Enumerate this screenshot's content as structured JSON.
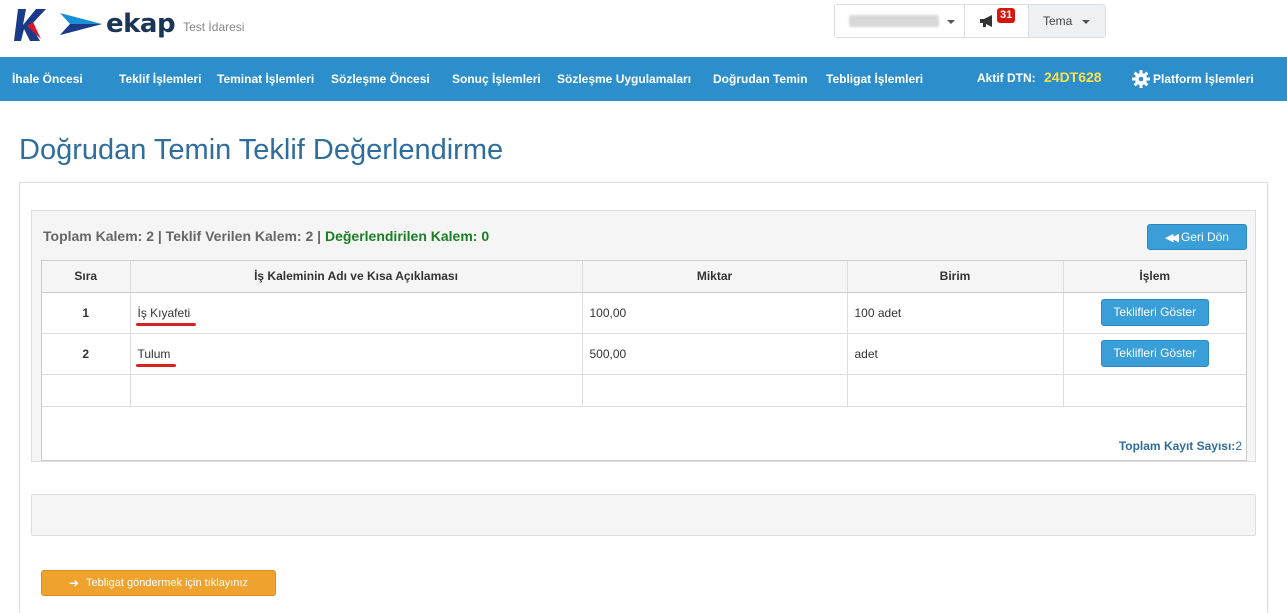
{
  "header": {
    "logo_text": "ekap",
    "org_name": "Test İdaresi",
    "notification_count": "31",
    "theme_label": "Tema"
  },
  "nav": {
    "items": [
      "İhale Öncesi",
      "Teklif İşlemleri",
      "Teminat İşlemleri",
      "Sözleşme Öncesi",
      "Sonuç İşlemleri",
      "Sözleşme Uygulamaları",
      "Doğrudan Temin",
      "Tebligat İşlemleri"
    ],
    "dtn_label": "Aktif DTN:",
    "dtn_value": "24DT628",
    "platform_label": "Platform İşlemleri"
  },
  "page": {
    "title": "Doğrudan Temin Teklif Değerlendirme"
  },
  "summary": {
    "text": "Toplam Kalem: 2 | Teklif Verilen Kalem: 2 | ",
    "evaluated": "Değerlendirilen Kalem: 0"
  },
  "back_button": "Geri Dön",
  "table": {
    "headers": [
      "Sıra",
      "İş Kaleminin Adı ve Kısa Açıklaması",
      "Miktar",
      "Birim",
      "İşlem"
    ],
    "rows": [
      {
        "sira": "1",
        "name": "İş Kıyafeti",
        "miktar": "100,00",
        "birim": "100 adet",
        "action": "Teklifleri Göster"
      },
      {
        "sira": "2",
        "name": "Tulum",
        "miktar": "500,00",
        "birim": "adet",
        "action": "Teklifleri Göster"
      }
    ],
    "total_label": "Toplam Kayıt Sayısı:",
    "total_value": "2"
  },
  "notify_button": "Tebligat göndermek için tıklayınız",
  "colors": {
    "nav_bg": "#2c8fcb",
    "dtn_value": "#f6e04d",
    "title": "#2f6d9d",
    "evaluated_green": "#1a7e25",
    "primary_button": "#3a9fd9",
    "warning_button": "#f0a22e",
    "badge_red": "#d9140d",
    "underline_red": "#d62222"
  }
}
